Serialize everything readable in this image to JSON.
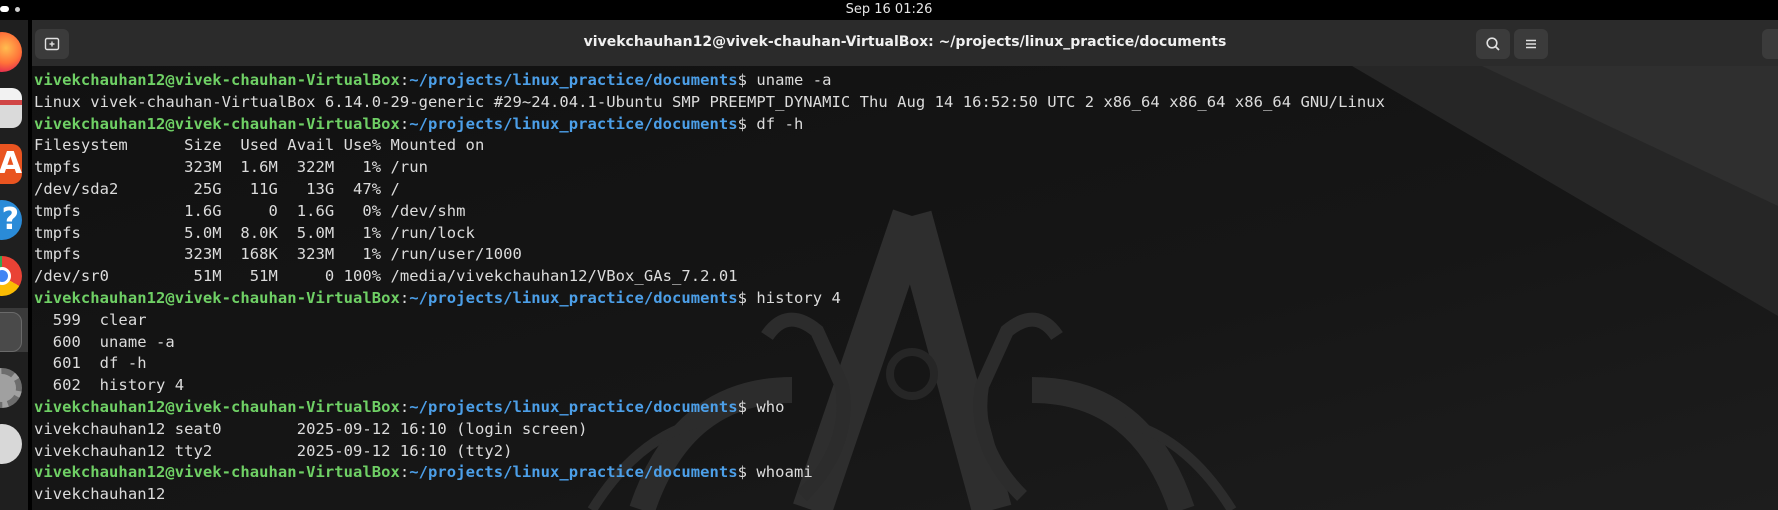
{
  "topbar": {
    "clock": "Sep 16  01:26"
  },
  "dock": {
    "items": [
      {
        "name": "firefox",
        "color": "#e8661e"
      },
      {
        "name": "files",
        "color": "#d9d9d9"
      },
      {
        "name": "app-center",
        "color": "#e95420"
      },
      {
        "name": "help",
        "color": "#2a8bd8"
      },
      {
        "name": "chrome",
        "color": "#3ba55c"
      },
      {
        "name": "terminal",
        "color": "#4a4a4a"
      },
      {
        "name": "settings",
        "color": "#9a9a9a"
      },
      {
        "name": "disc",
        "color": "#cccccc"
      }
    ]
  },
  "window": {
    "title": "vivekchauhan12@vivek-chauhan-VirtualBox: ~/projects/linux_practice/documents",
    "icons": {
      "new_tab": "new-tab-icon",
      "search": "search-icon",
      "menu": "hamburger-menu-icon"
    }
  },
  "prompt": {
    "user_host": "vivekchauhan12@vivek-chauhan-VirtualBox",
    "colon": ":",
    "path": "~/projects/linux_practice/documents",
    "symbol": "$ "
  },
  "terminal": {
    "lines": [
      {
        "type": "prompt",
        "command": "uname -a"
      },
      {
        "type": "output",
        "text": "Linux vivek-chauhan-VirtualBox 6.14.0-29-generic #29~24.04.1-Ubuntu SMP PREEMPT_DYNAMIC Thu Aug 14 16:52:50 UTC 2 x86_64 x86_64 x86_64 GNU/Linux"
      },
      {
        "type": "prompt",
        "command": "df -h"
      },
      {
        "type": "output",
        "text": "Filesystem      Size  Used Avail Use% Mounted on"
      },
      {
        "type": "output",
        "text": "tmpfs           323M  1.6M  322M   1% /run"
      },
      {
        "type": "output",
        "text": "/dev/sda2        25G   11G   13G  47% /"
      },
      {
        "type": "output",
        "text": "tmpfs           1.6G     0  1.6G   0% /dev/shm"
      },
      {
        "type": "output",
        "text": "tmpfs           5.0M  8.0K  5.0M   1% /run/lock"
      },
      {
        "type": "output",
        "text": "tmpfs           323M  168K  323M   1% /run/user/1000"
      },
      {
        "type": "output",
        "text": "/dev/sr0         51M   51M     0 100% /media/vivekchauhan12/VBox_GAs_7.2.01"
      },
      {
        "type": "prompt",
        "command": "history 4"
      },
      {
        "type": "output",
        "text": "  599  clear"
      },
      {
        "type": "output",
        "text": "  600  uname -a"
      },
      {
        "type": "output",
        "text": "  601  df -h"
      },
      {
        "type": "output",
        "text": "  602  history 4"
      },
      {
        "type": "prompt",
        "command": "who"
      },
      {
        "type": "output",
        "text": "vivekchauhan12 seat0        2025-09-12 16:10 (login screen)"
      },
      {
        "type": "output",
        "text": "vivekchauhan12 tty2         2025-09-12 16:10 (tty2)"
      },
      {
        "type": "prompt",
        "command": "whoami"
      },
      {
        "type": "output",
        "text": "vivekchauhan12"
      }
    ]
  },
  "colors": {
    "prompt_user": "#6fd065",
    "prompt_path": "#4c9fe8",
    "text": "#dcdcdc",
    "titlebar": "#2b2b2b"
  }
}
